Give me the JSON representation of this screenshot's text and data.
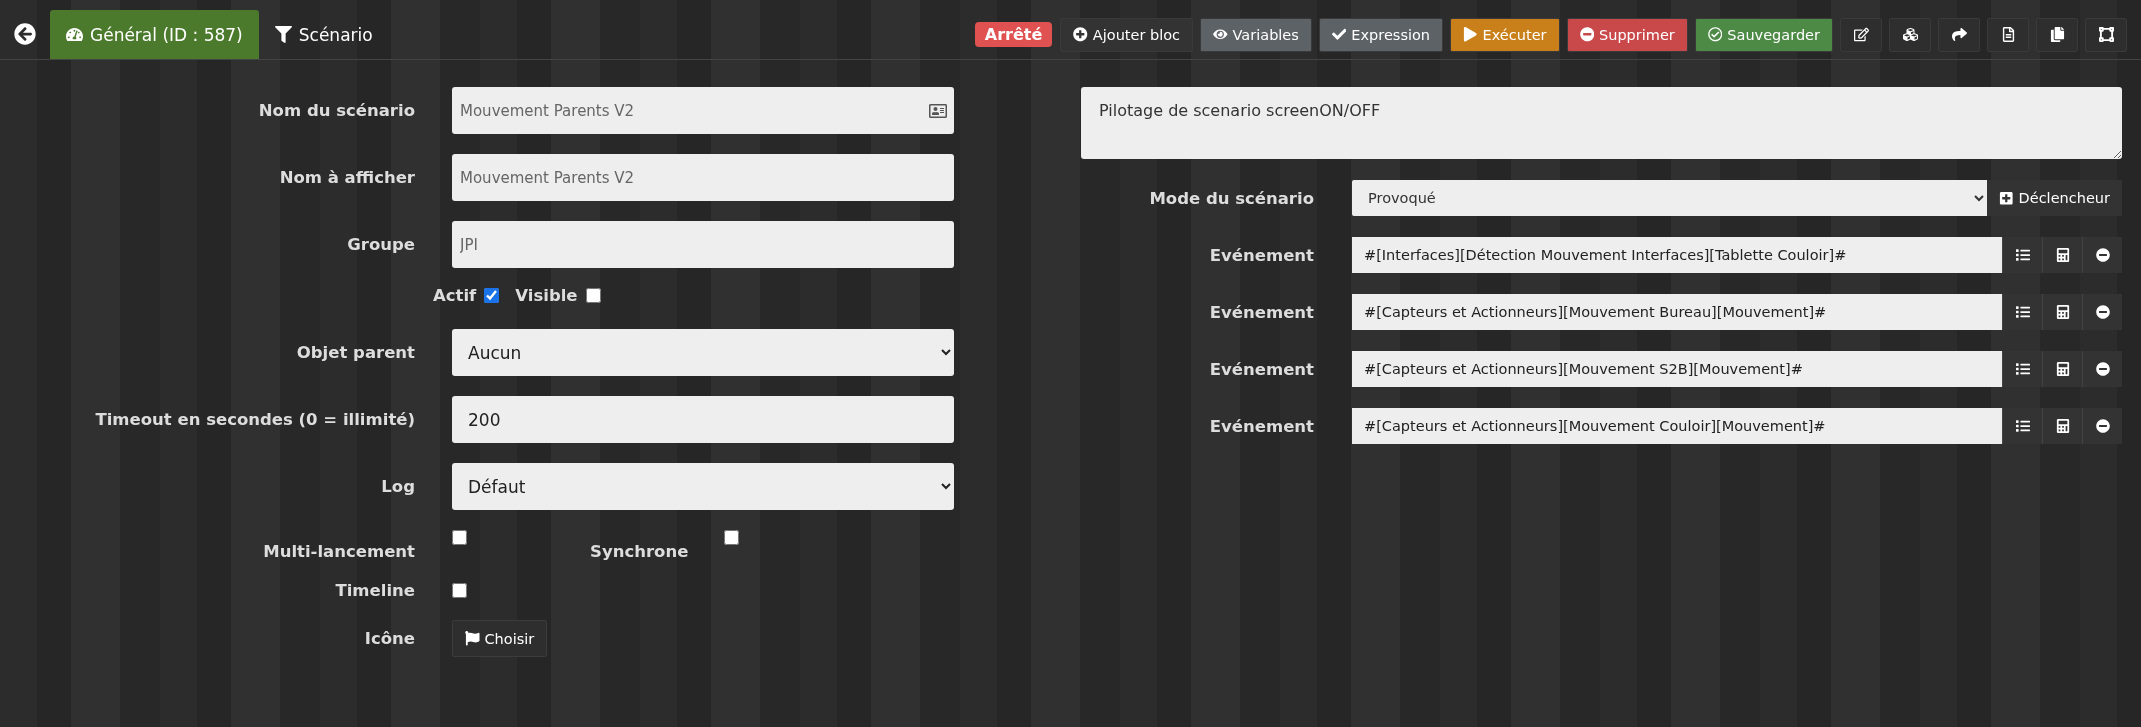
{
  "nav": {
    "tabs": [
      {
        "label": "Général (ID : 587)",
        "selected": true,
        "kind": "general"
      },
      {
        "label": "Scénario",
        "selected": false,
        "kind": "scenario"
      }
    ]
  },
  "status": "Arrêté",
  "actions": [
    {
      "label": "Ajouter bloc",
      "kind": "add"
    },
    {
      "label": "Variables",
      "kind": "variables"
    },
    {
      "label": "Expression",
      "kind": "expression"
    },
    {
      "label": "Exécuter",
      "kind": "run"
    },
    {
      "label": "Supprimer",
      "kind": "delete"
    },
    {
      "label": "Sauvegarder",
      "kind": "save"
    }
  ],
  "general": {
    "fields": [
      {
        "label": "Nom du scénario",
        "value": "Mouvement Parents V2",
        "kind": "text-card"
      },
      {
        "label": "Nom à afficher",
        "value": "Mouvement Parents V2",
        "kind": "text"
      },
      {
        "label": "Groupe",
        "value": "JPI",
        "kind": "text"
      }
    ],
    "flags": [
      {
        "label": "Actif",
        "checked": true
      },
      {
        "label": "Visible",
        "checked": false
      }
    ],
    "settings": [
      {
        "label": "Objet parent",
        "value": "Aucun",
        "kind": "select"
      },
      {
        "label": "Timeout en secondes (0 = illimité)",
        "value": "200",
        "kind": "number"
      },
      {
        "label": "Log",
        "value": "Défaut",
        "kind": "select"
      }
    ],
    "options": [
      {
        "label": "Multi-lancement",
        "checked": false
      },
      {
        "label": "Synchrone",
        "checked": false
      },
      {
        "label": "Timeline",
        "checked": false
      }
    ],
    "icon": {
      "label": "Icône",
      "button": "Choisir"
    }
  },
  "description": "Pilotage de scenario screenON/OFF",
  "mode": {
    "label": "Mode du scénario",
    "value": "Provoqué",
    "button": "Déclencheur"
  },
  "events": [
    {
      "label": "Evénement",
      "value": "#[Interfaces][Détection Mouvement Interfaces][Tablette Couloir]#"
    },
    {
      "label": "Evénement",
      "value": "#[Capteurs et Actionneurs][Mouvement Bureau][Mouvement]#"
    },
    {
      "label": "Evénement",
      "value": "#[Capteurs et Actionneurs][Mouvement S2B][Mouvement]#"
    },
    {
      "label": "Evénement",
      "value": "#[Capteurs et Actionneurs][Mouvement Couloir][Mouvement]#"
    }
  ]
}
